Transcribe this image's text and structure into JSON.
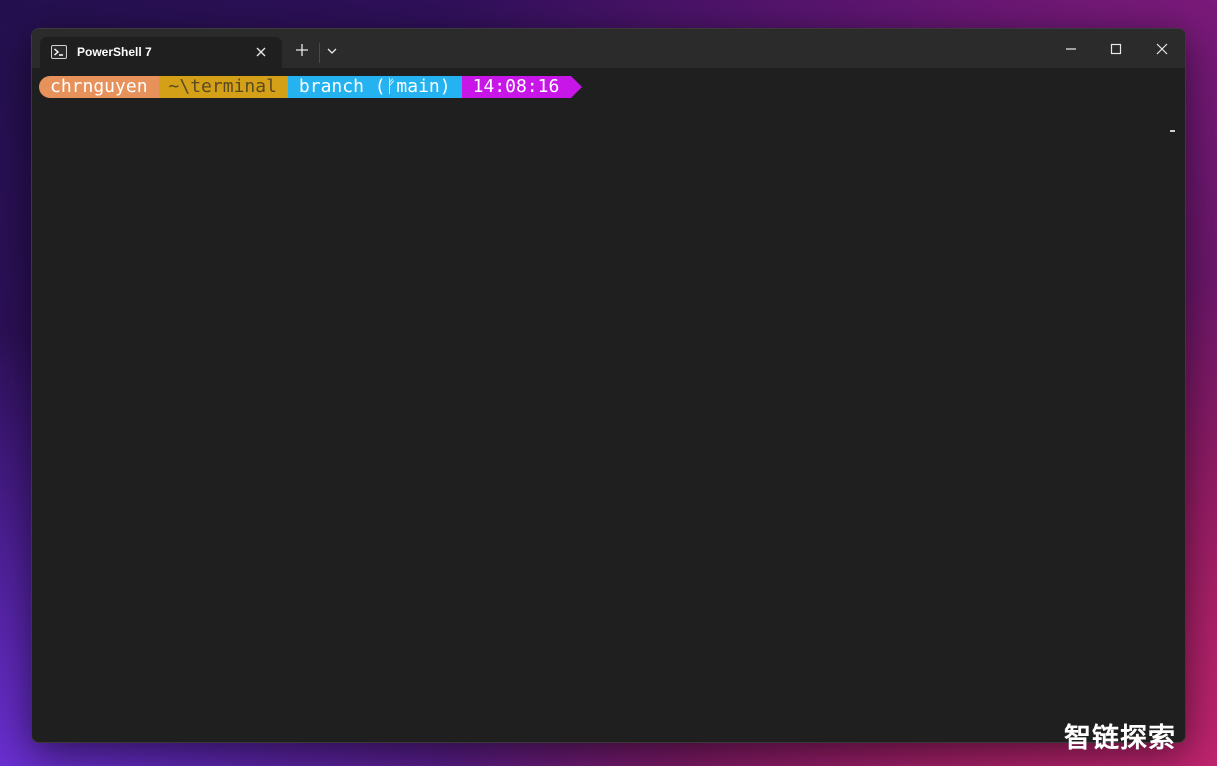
{
  "tab": {
    "title": "PowerShell 7",
    "icon": "powershell-icon"
  },
  "titlebar": {
    "new_tab_icon": "plus-icon",
    "dropdown_icon": "chevron-down-icon",
    "minimize_icon": "minimize-icon",
    "maximize_icon": "maximize-icon",
    "close_icon": "close-icon"
  },
  "prompt": {
    "user": "chrnguyen",
    "path": "~\\terminal",
    "branch": "branch (ᚠmain)",
    "time": "14:08:16"
  },
  "colors": {
    "user_bg": "#e8925b",
    "path_bg": "#d4a017",
    "branch_bg": "#24b3f0",
    "time_bg": "#c816e8",
    "terminal_bg": "#1f1f1f",
    "titlebar_bg": "#2b2b2b"
  },
  "watermark": "智链探索"
}
